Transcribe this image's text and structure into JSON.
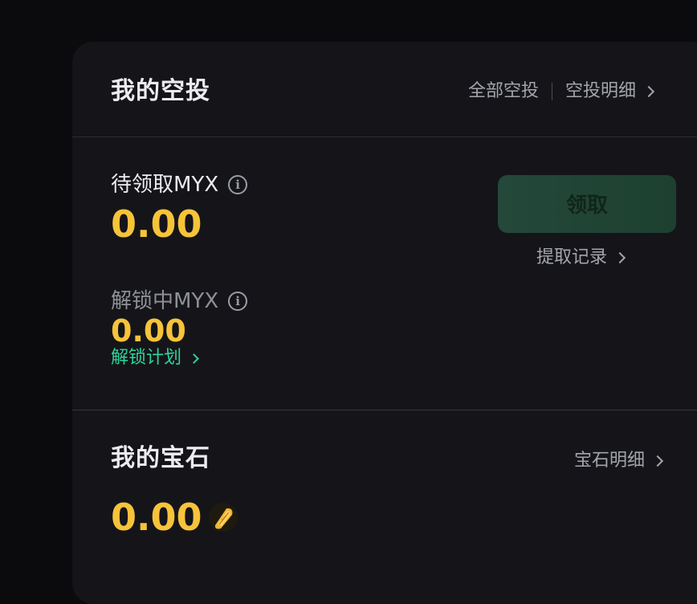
{
  "airdrop": {
    "title": "我的空投",
    "all_airdrops_link": "全部空投",
    "airdrop_details_link": "空投明细"
  },
  "claimable": {
    "label": "待领取MYX",
    "value": "0.00",
    "info_glyph": "i"
  },
  "unlocking": {
    "label": "解锁中MYX",
    "value": "0.00",
    "info_glyph": "i",
    "plan_link": "解锁计划"
  },
  "claim": {
    "button_label": "领取",
    "records_link": "提取记录"
  },
  "gems": {
    "title": "我的宝石",
    "details_link": "宝石明细",
    "value": "0.00",
    "icon": "gem-icon"
  },
  "colors": {
    "accent_value": "#f6c33a",
    "link_green": "#2fd39a",
    "button_bg": "#24483a",
    "card_bg": "#151519",
    "page_bg": "#0b0b0d"
  }
}
